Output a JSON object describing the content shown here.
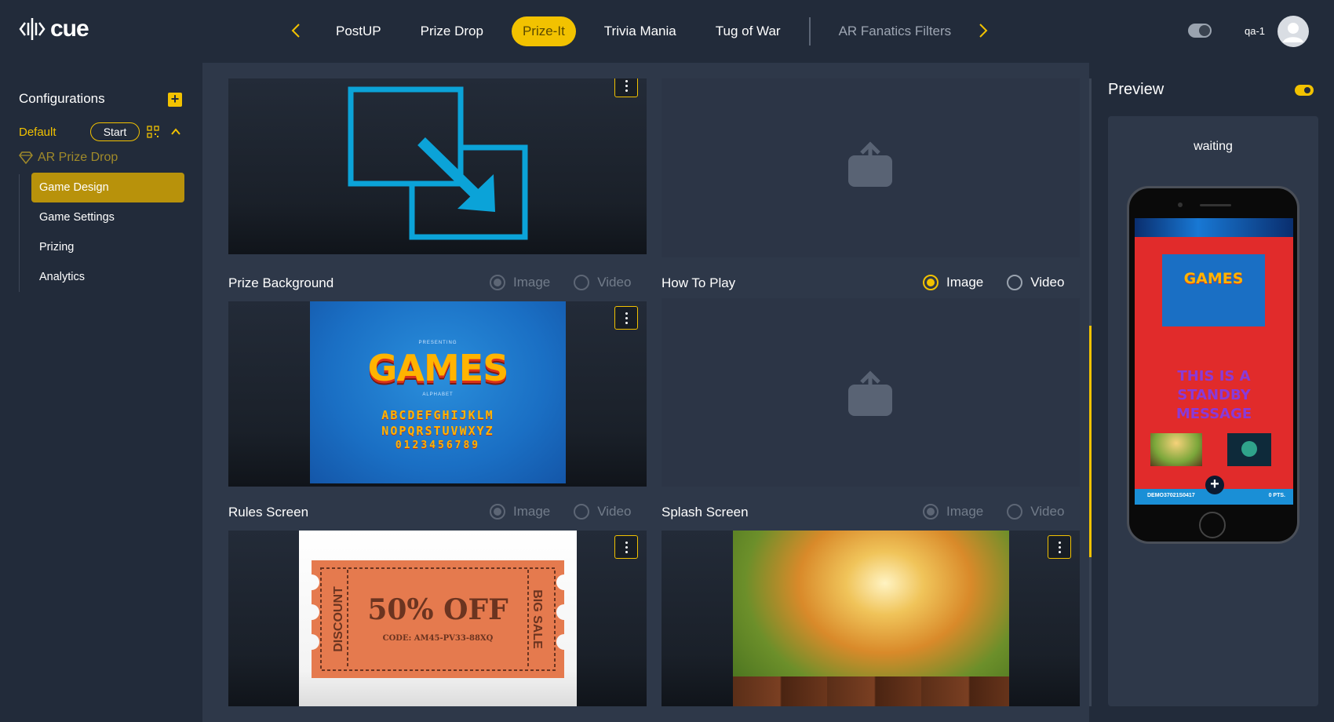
{
  "app": {
    "logo_text": "cue"
  },
  "nav": {
    "tabs": [
      {
        "label": "PostUP",
        "state": "normal"
      },
      {
        "label": "Prize Drop",
        "state": "normal"
      },
      {
        "label": "Prize-It",
        "state": "active"
      },
      {
        "label": "Trivia Mania",
        "state": "normal"
      },
      {
        "label": "Tug of War",
        "state": "normal"
      },
      {
        "label": "AR Fanatics Filters",
        "state": "dim"
      }
    ]
  },
  "user": {
    "name": "qa-1"
  },
  "sidebar": {
    "title": "Configurations",
    "default_label": "Default",
    "start_label": "Start",
    "game_name": "AR Prize Drop",
    "items": [
      {
        "label": "Game Design",
        "active": true
      },
      {
        "label": "Game Settings",
        "active": false
      },
      {
        "label": "Prizing",
        "active": false
      },
      {
        "label": "Analytics",
        "active": false
      }
    ]
  },
  "sections": {
    "prize_background": {
      "label": "Prize Background",
      "image_label": "Image",
      "video_label": "Video",
      "selected": "Image"
    },
    "how_to_play": {
      "label": "How To Play",
      "image_label": "Image",
      "video_label": "Video",
      "selected": "Image"
    },
    "rules_screen": {
      "label": "Rules Screen",
      "image_label": "Image",
      "video_label": "Video",
      "selected": "Image"
    },
    "splash_screen": {
      "label": "Splash Screen",
      "image_label": "Image",
      "video_label": "Video",
      "selected": "Image"
    }
  },
  "thumbnails": {
    "games": {
      "presenting": "PRESENTING",
      "title": "GAMES",
      "subtitle": "ALPHABET",
      "line1": "ABCDEFGHIJKLM",
      "line2": "NOPQRSTUVWXYZ",
      "line3": "0123456789"
    },
    "ticket": {
      "main": "50% OFF",
      "code": "CODE: AM45-PV33-88XQ",
      "left": "DISCOUNT",
      "right": "BIG SALE"
    }
  },
  "preview": {
    "title": "Preview",
    "status": "waiting",
    "standby_message": "THIS IS A STANDBY MESSAGE",
    "bottom_left": "DEMO37021S0417",
    "bottom_right": "0 PTS."
  },
  "colors": {
    "accent": "#f2c200",
    "background": "#222b3a",
    "panel": "#2e3849",
    "active_item": "#b8920b"
  }
}
